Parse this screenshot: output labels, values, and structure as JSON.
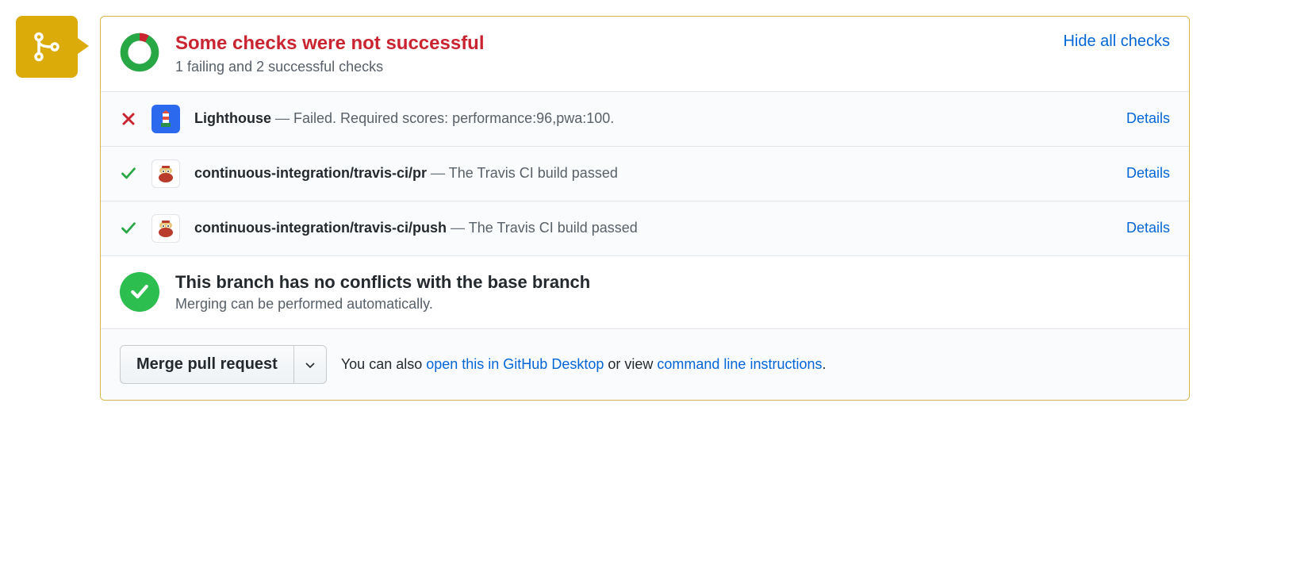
{
  "summary": {
    "heading": "Some checks were not successful",
    "sub": "1 failing and 2 successful checks",
    "hide_link": "Hide all checks"
  },
  "checks": [
    {
      "status": "fail",
      "avatar": "lighthouse",
      "name": "Lighthouse",
      "msg": "Failed. Required scores: performance:96,pwa:100.",
      "details": "Details"
    },
    {
      "status": "pass",
      "avatar": "travis",
      "name": "continuous-integration/travis-ci/pr",
      "msg": "The Travis CI build passed",
      "details": "Details"
    },
    {
      "status": "pass",
      "avatar": "travis",
      "name": "continuous-integration/travis-ci/push",
      "msg": "The Travis CI build passed",
      "details": "Details"
    }
  ],
  "conflicts": {
    "heading": "This branch has no conflicts with the base branch",
    "sub": "Merging can be performed automatically."
  },
  "footer": {
    "merge_btn": "Merge pull request",
    "hint_prefix": "You can also ",
    "link_desktop": "open this in GitHub Desktop",
    "hint_middle": " or view ",
    "link_cli": "command line instructions",
    "hint_suffix": "."
  }
}
